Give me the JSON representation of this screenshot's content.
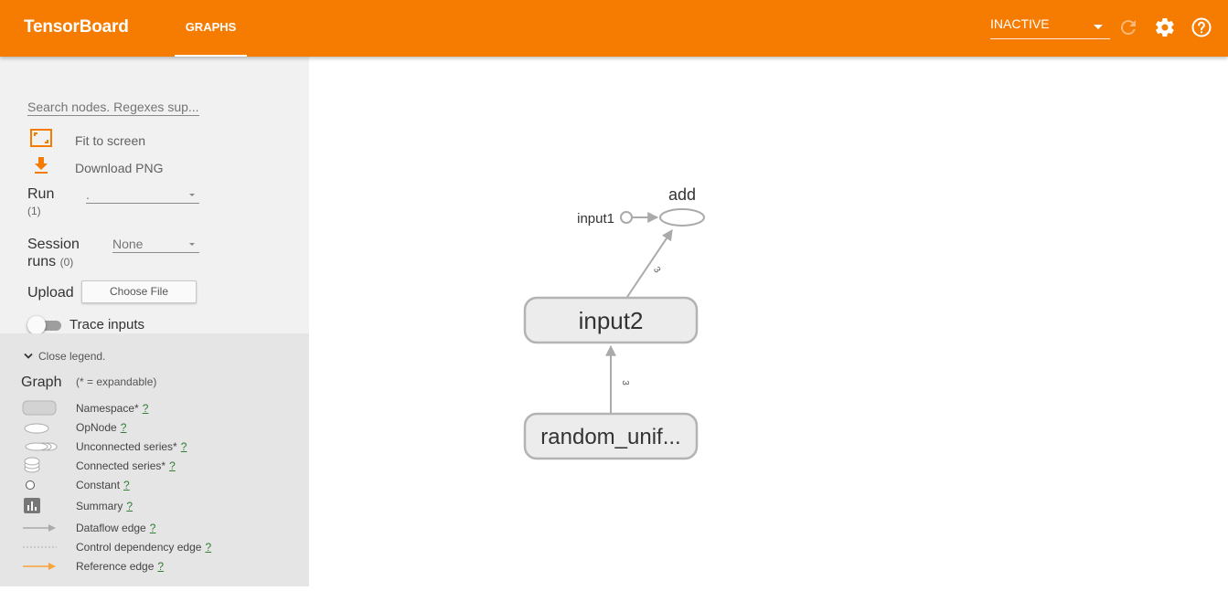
{
  "header": {
    "title": "TensorBoard",
    "tabs": [
      {
        "label": "GRAPHS",
        "active": true
      }
    ],
    "run_status": "INACTIVE",
    "accent_color": "#f57c00"
  },
  "sidebar": {
    "search_placeholder": "Search nodes. Regexes sup...",
    "fit_to_screen": "Fit to screen",
    "download_png": "Download PNG",
    "run_label": "Run",
    "run_count": "(1)",
    "run_value": ".",
    "session_label_1": "Session",
    "session_label_2": "runs",
    "session_count": "(0)",
    "session_value": "None",
    "upload_label": "Upload",
    "choose_file": "Choose File",
    "trace_inputs": "Trace inputs"
  },
  "legend": {
    "toggle": "Close legend.",
    "title": "Graph",
    "subtitle": "(* = expandable)",
    "help_mark": "?",
    "items": [
      {
        "label": "Namespace*",
        "icon": "namespace-icon"
      },
      {
        "label": "OpNode",
        "icon": "opnode-icon"
      },
      {
        "label": "Unconnected series*",
        "icon": "unconnected-series-icon"
      },
      {
        "label": "Connected series*",
        "icon": "connected-series-icon"
      },
      {
        "label": "Constant",
        "icon": "constant-icon"
      },
      {
        "label": "Summary",
        "icon": "summary-icon"
      },
      {
        "label": "Dataflow edge",
        "icon": "dataflow-edge-icon"
      },
      {
        "label": "Control dependency edge",
        "icon": "control-edge-icon"
      },
      {
        "label": "Reference edge",
        "icon": "reference-edge-icon"
      }
    ]
  },
  "graph": {
    "nodes": {
      "add": "add",
      "input1": "input1",
      "input2": "input2",
      "random": "random_unif..."
    },
    "edges": {
      "input2_to_add": "3",
      "random_to_input2": "3"
    }
  }
}
